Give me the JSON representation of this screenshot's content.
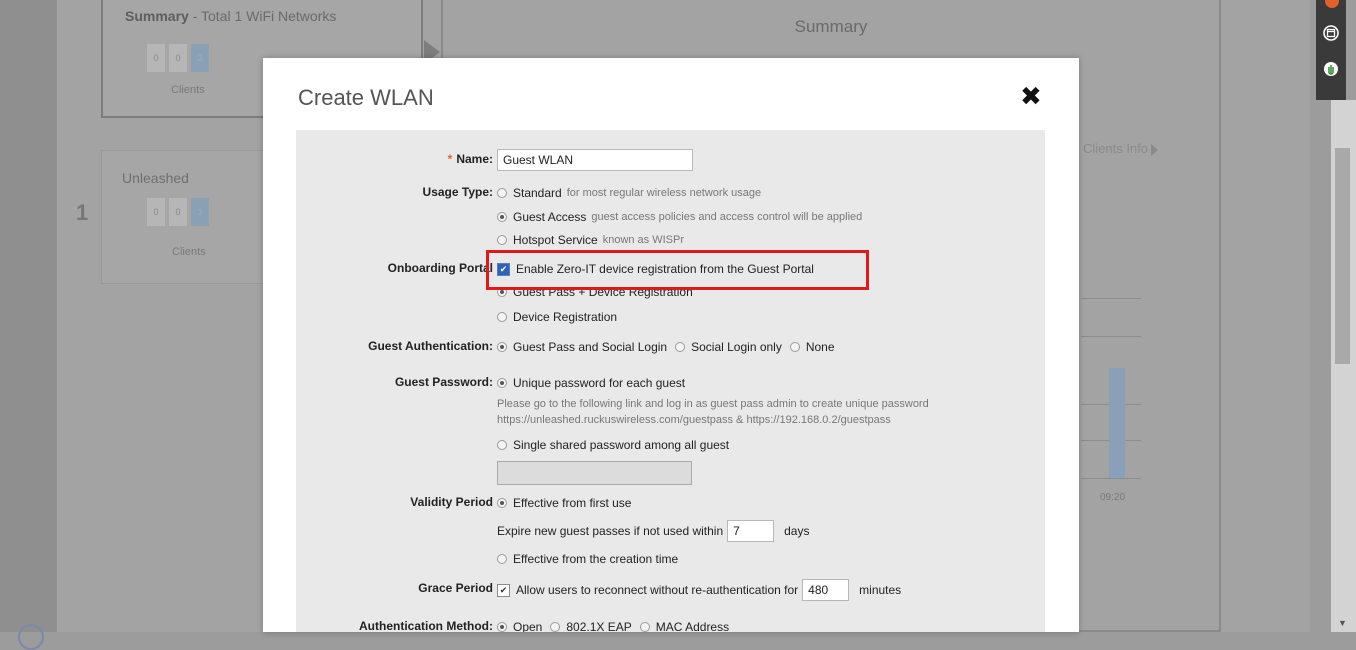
{
  "background": {
    "summary_panel": {
      "title_bold": "Summary",
      "title_rest": " - Total 1 WiFi Networks",
      "counters": [
        "0",
        "0",
        "3"
      ],
      "clients_label": "Clients"
    },
    "summary_header": "Summary",
    "unleashed_panel": {
      "title": "Unleashed",
      "index": "1",
      "counters": [
        "0",
        "0",
        "3"
      ],
      "clients_label": "Clients"
    },
    "clients_info_link": "Clients Info",
    "chart_time_label": "09:20"
  },
  "toolbar": {
    "icons": [
      "notification-icon",
      "window-icon",
      "hand-pointer-icon"
    ]
  },
  "modal": {
    "title": "Create WLAN",
    "close_label": "✖",
    "form": {
      "name": {
        "label": "Name:",
        "required_mark": "*",
        "value": "Guest WLAN"
      },
      "usage_type": {
        "label": "Usage Type:",
        "options": [
          {
            "label": "Standard",
            "hint": "for most regular wireless network usage",
            "selected": false
          },
          {
            "label": "Guest Access",
            "hint": "guest access policies and access control will be applied",
            "selected": true
          },
          {
            "label": "Hotspot Service",
            "hint": "known as WISPr",
            "selected": false
          }
        ]
      },
      "onboarding_portal": {
        "label": "Onboarding Portal",
        "checkbox_label": "Enable Zero-IT device registration from the Guest Portal",
        "checked": true,
        "options": [
          {
            "label": "Guest Pass + Device Registration",
            "selected": true
          },
          {
            "label": "Device Registration",
            "selected": false
          }
        ]
      },
      "guest_authentication": {
        "label": "Guest Authentication:",
        "options": [
          {
            "label": "Guest Pass and Social Login",
            "selected": true
          },
          {
            "label": "Social Login only",
            "selected": false
          },
          {
            "label": "None",
            "selected": false
          }
        ]
      },
      "guest_password": {
        "label": "Guest Password:",
        "unique_option": "Unique password for each guest",
        "note_line1": "Please go to the following link and log in as guest pass admin to create unique password",
        "note_line2": "https://unleashed.ruckuswireless.com/guestpass & https://192.168.0.2/guestpass",
        "shared_option": "Single shared password among all guest",
        "shared_value": ""
      },
      "validity_period": {
        "label": "Validity Period",
        "first_use_option": "Effective from first use",
        "expire_prefix": "Expire new guest passes if not used within",
        "expire_days": "7",
        "expire_unit": "days",
        "creation_option": "Effective from the creation time"
      },
      "grace_period": {
        "label": "Grace Period",
        "checkbox_label": "Allow users to reconnect without re-authentication for",
        "checked": true,
        "minutes": "480",
        "unit": "minutes"
      },
      "authentication_method": {
        "label": "Authentication Method:",
        "options": [
          {
            "label": "Open",
            "selected": true
          },
          {
            "label": "802.1X EAP",
            "selected": false
          },
          {
            "label": "MAC Address",
            "selected": false
          }
        ]
      }
    }
  },
  "colors": {
    "highlight": "#e01a1a",
    "required": "#e2641c",
    "checkbox": "#2f63b8"
  }
}
